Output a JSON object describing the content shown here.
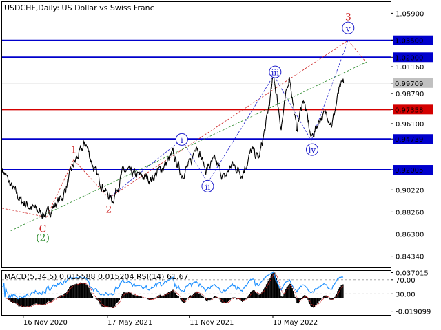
{
  "header": {
    "symbol": "USDCHF",
    "timeframe": "Daily",
    "description": "US Dollar vs Swiss Franc"
  },
  "chart_data": [
    {
      "type": "line",
      "panel": "price",
      "ylim": [
        0.8334,
        1.069
      ],
      "xlim": [
        "2020-10-01",
        "2023-01-20"
      ],
      "y_ticks": [
        "1.05900",
        "1.03530",
        "1.01160",
        "0.98790",
        "0.97358",
        "0.96100",
        "0.94739",
        "0.92005",
        "0.90220",
        "0.88260",
        "0.86300",
        "0.84340"
      ],
      "y_tick_values": [
        1.059,
        1.0353,
        1.0116,
        0.9879,
        0.97358,
        0.961,
        0.94739,
        0.92005,
        0.9022,
        0.8826,
        0.863,
        0.8434
      ],
      "x_tick_labels": [
        "16 Nov 2020",
        "17 May 2021",
        "11 Nov 2021",
        "10 May 2022"
      ],
      "x_tick_dates": [
        "2020-11-16",
        "2021-05-17",
        "2021-11-11",
        "2022-05-10"
      ],
      "current_price": {
        "label": "0.99709",
        "value": 0.99709
      },
      "price_series": {
        "name": "USDCHF",
        "color": "#000000",
        "anchors": [
          [
            "2020-10-01",
            0.921
          ],
          [
            "2020-10-20",
            0.906
          ],
          [
            "2020-11-10",
            0.893
          ],
          [
            "2020-12-01",
            0.887
          ],
          [
            "2021-01-05",
            0.88
          ],
          [
            "2021-02-10",
            0.897
          ],
          [
            "2021-03-05",
            0.925
          ],
          [
            "2021-03-31",
            0.944
          ],
          [
            "2021-04-20",
            0.918
          ],
          [
            "2021-05-15",
            0.9
          ],
          [
            "2021-05-28",
            0.893
          ],
          [
            "2021-06-20",
            0.919
          ],
          [
            "2021-07-20",
            0.915
          ],
          [
            "2021-08-20",
            0.912
          ],
          [
            "2021-09-20",
            0.925
          ],
          [
            "2021-10-06",
            0.934
          ],
          [
            "2021-10-25",
            0.916
          ],
          [
            "2021-11-15",
            0.927
          ],
          [
            "2021-11-25",
            0.945
          ],
          [
            "2021-12-15",
            0.92
          ],
          [
            "2022-01-05",
            0.928
          ],
          [
            "2022-01-25",
            0.912
          ],
          [
            "2022-02-10",
            0.925
          ],
          [
            "2022-03-05",
            0.917
          ],
          [
            "2022-03-25",
            0.937
          ],
          [
            "2022-04-10",
            0.93
          ],
          [
            "2022-04-25",
            0.96
          ],
          [
            "2022-05-12",
            1.004
          ],
          [
            "2022-05-28",
            0.958
          ],
          [
            "2022-06-15",
            1.005
          ],
          [
            "2022-06-30",
            0.955
          ],
          [
            "2022-07-15",
            0.984
          ],
          [
            "2022-08-01",
            0.948
          ],
          [
            "2022-08-22",
            0.967
          ],
          [
            "2022-09-05",
            0.97
          ],
          [
            "2022-09-15",
            0.96
          ],
          [
            "2022-09-30",
            0.99
          ],
          [
            "2022-10-10",
            0.997
          ]
        ]
      },
      "levels": [
        {
          "label": "1.03500",
          "value": 1.035,
          "color": "#0000cc"
        },
        {
          "label": "1.02000",
          "value": 1.02,
          "color": "#0000cc"
        },
        {
          "label": "0.97358",
          "value": 0.97358,
          "color": "#d40000"
        },
        {
          "label": "0.94739",
          "value": 0.94739,
          "color": "#0000cc"
        },
        {
          "label": "0.92005",
          "value": 0.92005,
          "color": "#0000cc"
        }
      ],
      "wave_lines": [
        {
          "color": "#cc2222",
          "points": [
            [
              "2020-10-01",
              0.886
            ],
            [
              "2021-01-05",
              0.878
            ],
            [
              "2021-03-05",
              0.929
            ],
            [
              "2021-05-20",
              0.895
            ],
            [
              "2022-10-20",
              1.035
            ],
            [
              "2022-11-25",
              1.017
            ]
          ]
        },
        {
          "color": "#2020cc",
          "points": [
            [
              "2021-05-20",
              0.895
            ],
            [
              "2021-10-25",
              0.947
            ],
            [
              "2021-12-20",
              0.9085
            ],
            [
              "2022-05-12",
              1.004
            ],
            [
              "2022-08-01",
              0.946
            ],
            [
              "2022-10-20",
              1.035
            ]
          ]
        },
        {
          "color": "#2a8a2a",
          "points": [
            [
              "2020-10-20",
              0.866
            ],
            [
              "2022-11-30",
              1.016
            ]
          ]
        }
      ],
      "wave_labels": [
        {
          "text": "(2)",
          "date": "2020-12-28",
          "value": 0.86,
          "color": "#2a8a2a",
          "circled": false
        },
        {
          "text": "C",
          "date": "2020-12-28",
          "value": 0.868,
          "color": "#cc2222",
          "circled": false
        },
        {
          "text": "1",
          "date": "2021-03-05",
          "value": 0.938,
          "color": "#cc2222",
          "circled": false
        },
        {
          "text": "2",
          "date": "2021-05-20",
          "value": 0.885,
          "color": "#cc2222",
          "circled": false
        },
        {
          "text": "i",
          "date": "2021-10-25",
          "value": 0.947,
          "color": "#2020cc",
          "circled": true
        },
        {
          "text": "ii",
          "date": "2021-12-20",
          "value": 0.9055,
          "color": "#2020cc",
          "circled": true
        },
        {
          "text": "iii",
          "date": "2022-05-15",
          "value": 1.007,
          "color": "#2020cc",
          "circled": true
        },
        {
          "text": "iv",
          "date": "2022-08-03",
          "value": 0.938,
          "color": "#2020cc",
          "circled": true
        },
        {
          "text": "3",
          "date": "2022-10-20",
          "value": 1.056,
          "color": "#cc2222",
          "circled": false
        },
        {
          "text": "v",
          "date": "2022-10-20",
          "value": 1.046,
          "color": "#2020cc",
          "circled": true
        }
      ]
    },
    {
      "type": "bar",
      "panel": "oscillator",
      "title": "MACD(5,34,5) 0.015588 0.015204 RSI(14) 61.67",
      "ylim": [
        -0.0245,
        0.0395
      ],
      "y_ticks": [
        "0.037015",
        "70.00",
        "30.00",
        "-0.019099"
      ],
      "y_tick_values": [
        0.037015,
        0.0267,
        0.0062,
        -0.019099
      ],
      "rsi_levels": [
        70,
        30
      ],
      "macd_color": "#000000",
      "signal_color": "#cc2222",
      "rsi_color": "#1e90ff"
    }
  ]
}
